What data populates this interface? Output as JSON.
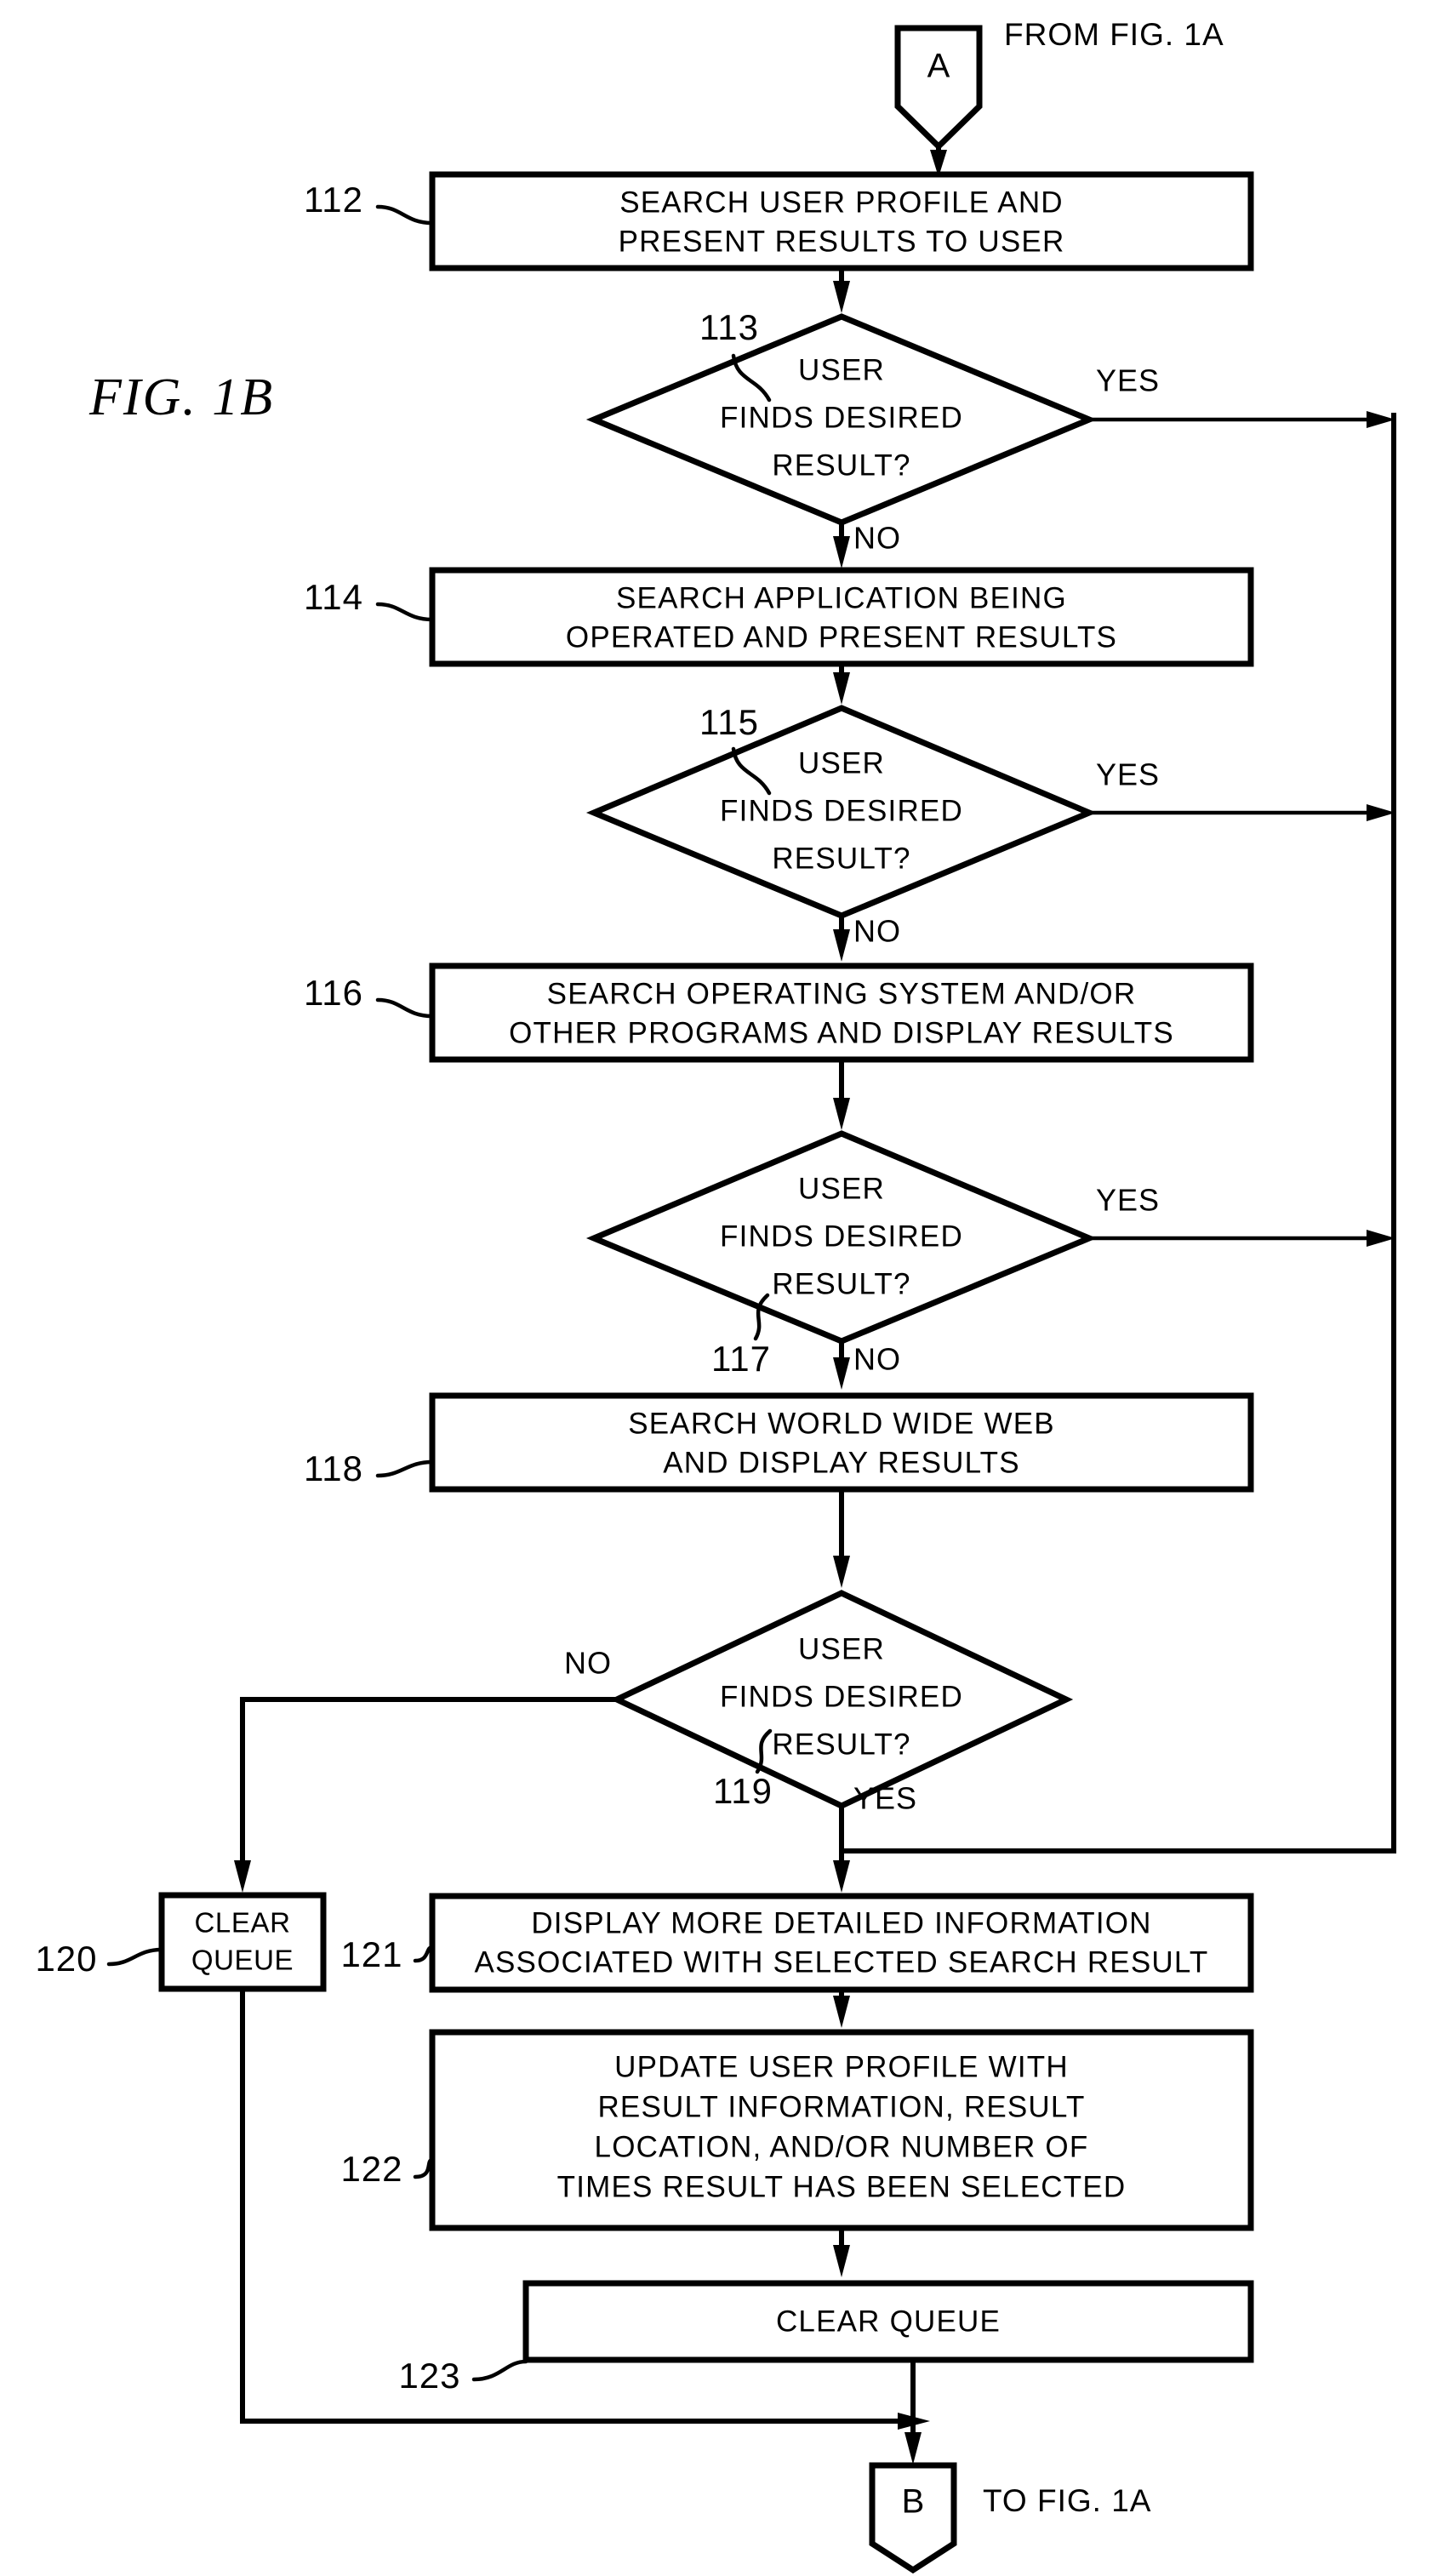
{
  "figure": {
    "label": "FIG.  1B"
  },
  "connectors": {
    "top": {
      "letter": "A",
      "note": "FROM FIG. 1A"
    },
    "bottom": {
      "letter": "B",
      "note": "TO FIG. 1A"
    }
  },
  "branch_labels": {
    "yes": "YES",
    "no": "NO"
  },
  "nodes": [
    {
      "ref": "112",
      "type": "process",
      "lines": [
        "SEARCH USER PROFILE AND",
        "PRESENT RESULTS TO USER"
      ]
    },
    {
      "ref": "113",
      "type": "decision",
      "lines": [
        "USER",
        "FINDS DESIRED",
        "RESULT?"
      ]
    },
    {
      "ref": "114",
      "type": "process",
      "lines": [
        "SEARCH APPLICATION BEING",
        "OPERATED AND PRESENT RESULTS"
      ]
    },
    {
      "ref": "115",
      "type": "decision",
      "lines": [
        "USER",
        "FINDS DESIRED",
        "RESULT?"
      ]
    },
    {
      "ref": "116",
      "type": "process",
      "lines": [
        "SEARCH OPERATING SYSTEM AND/OR",
        "OTHER PROGRAMS AND DISPLAY RESULTS"
      ]
    },
    {
      "ref": "117",
      "type": "decision",
      "lines": [
        "USER",
        "FINDS DESIRED",
        "RESULT?"
      ]
    },
    {
      "ref": "118",
      "type": "process",
      "lines": [
        "SEARCH WORLD WIDE WEB",
        "AND DISPLAY RESULTS"
      ]
    },
    {
      "ref": "119",
      "type": "decision",
      "lines": [
        "USER",
        "FINDS DESIRED",
        "RESULT?"
      ]
    },
    {
      "ref": "120",
      "type": "process",
      "lines": [
        "CLEAR",
        "QUEUE"
      ]
    },
    {
      "ref": "121",
      "type": "process",
      "lines": [
        "DISPLAY MORE DETAILED INFORMATION",
        "ASSOCIATED WITH SELECTED SEARCH RESULT"
      ]
    },
    {
      "ref": "122",
      "type": "process",
      "lines": [
        "UPDATE USER PROFILE WITH",
        "RESULT INFORMATION, RESULT",
        "LOCATION, AND/OR NUMBER OF",
        "TIMES RESULT HAS BEEN SELECTED"
      ]
    },
    {
      "ref": "123",
      "type": "process",
      "lines": [
        "CLEAR QUEUE"
      ]
    }
  ],
  "colors": {
    "ink": "#000000",
    "paper": "#ffffff"
  }
}
